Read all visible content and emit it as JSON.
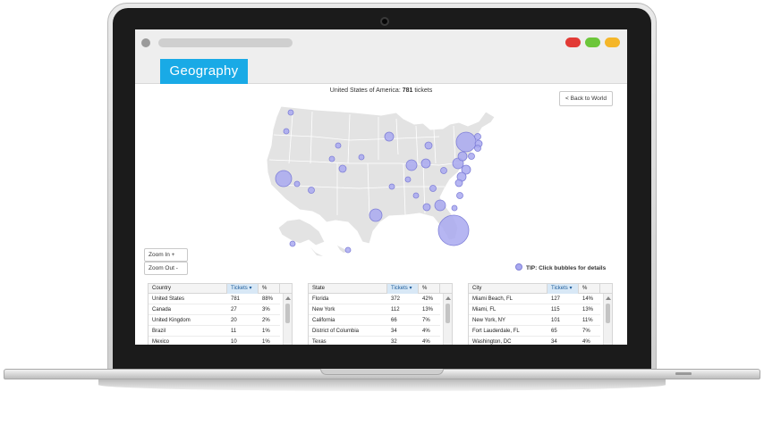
{
  "geography_tab": "Geography",
  "map": {
    "title_prefix": "United States of America:",
    "ticket_count": "781",
    "title_suffix": "tickets",
    "back_button": "< Back to World",
    "zoom_in": "Zoom In +",
    "zoom_out": "Zoom Out -",
    "tip": "TIP: Click bubbles for details",
    "bubble_color": "#a9a9f0",
    "bubble_stroke": "#8080d8",
    "land_color": "#e3e3e3"
  },
  "colors": {
    "accent": "#19aae6",
    "window_red": "#e23a35",
    "window_green": "#6cc63a",
    "window_yellow": "#f5b629"
  },
  "tables": [
    {
      "columns": [
        "Country",
        "Tickets ▾",
        "%"
      ],
      "rows": [
        [
          "United States",
          "781",
          "88%"
        ],
        [
          "Canada",
          "27",
          "3%"
        ],
        [
          "United Kingdom",
          "20",
          "2%"
        ],
        [
          "Brazil",
          "11",
          "1%"
        ],
        [
          "Mexico",
          "10",
          "1%"
        ]
      ]
    },
    {
      "columns": [
        "State",
        "Tickets ▾",
        "%"
      ],
      "rows": [
        [
          "Florida",
          "372",
          "42%"
        ],
        [
          "New York",
          "112",
          "13%"
        ],
        [
          "California",
          "66",
          "7%"
        ],
        [
          "District of Columbia",
          "34",
          "4%"
        ],
        [
          "Texas",
          "32",
          "4%"
        ]
      ]
    },
    {
      "columns": [
        "City",
        "Tickets ▾",
        "%"
      ],
      "rows": [
        [
          "Miami Beach, FL",
          "127",
          "14%"
        ],
        [
          "Miami, FL",
          "115",
          "13%"
        ],
        [
          "New York, NY",
          "101",
          "11%"
        ],
        [
          "Fort Lauderdale, FL",
          "65",
          "7%"
        ],
        [
          "Washington, DC",
          "34",
          "4%"
        ]
      ]
    }
  ]
}
